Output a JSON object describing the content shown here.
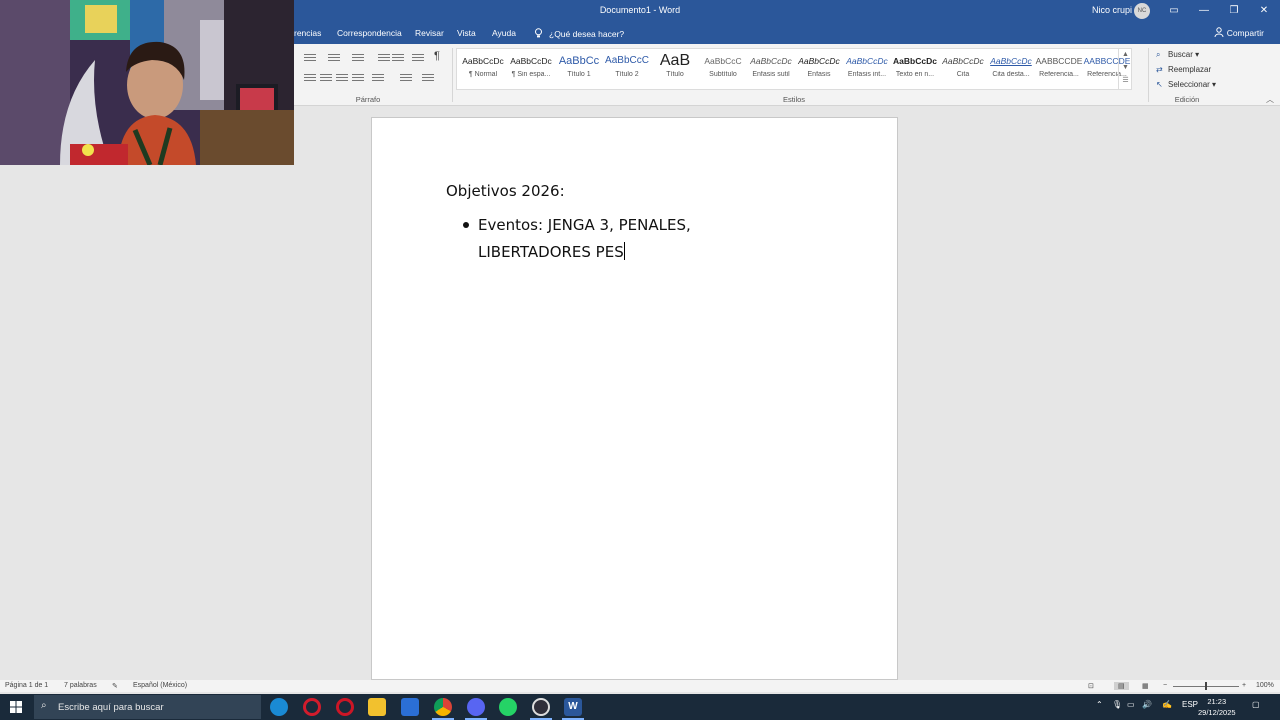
{
  "window": {
    "title": "Documento1 - Word",
    "user_name": "Nico crupi",
    "user_initials": "NC",
    "controls": {
      "minimize": "—",
      "restore": "❐",
      "close": "✕"
    },
    "ribbon_display_icon": "▭"
  },
  "menu": {
    "tabs": [
      "rencias",
      "Correspondencia",
      "Revisar",
      "Vista",
      "Ayuda"
    ],
    "tell_me": "¿Qué desea hacer?",
    "share": "Compartir"
  },
  "ribbon": {
    "paragraph_label": "Párrafo",
    "styles_label": "Estilos",
    "editing_label": "Edición",
    "pilcrow": "¶",
    "styles": [
      {
        "sample": "AaBbCcDc",
        "name": "¶ Normal"
      },
      {
        "sample": "AaBbCcDc",
        "name": "¶ Sin espa..."
      },
      {
        "sample": "AaBbCc",
        "name": "Título 1"
      },
      {
        "sample": "AaBbCcC",
        "name": "Título 2"
      },
      {
        "sample": "AaB",
        "name": "Título"
      },
      {
        "sample": "AaBbCcC",
        "name": "Subtítulo"
      },
      {
        "sample": "AaBbCcDc",
        "name": "Énfasis sutil"
      },
      {
        "sample": "AaBbCcDc",
        "name": "Énfasis"
      },
      {
        "sample": "AaBbCcDc",
        "name": "Énfasis int..."
      },
      {
        "sample": "AaBbCcDc",
        "name": "Texto en n..."
      },
      {
        "sample": "AaBbCcDc",
        "name": "Cita"
      },
      {
        "sample": "AaBbCcDc",
        "name": "Cita desta..."
      },
      {
        "sample": "AABBCCDE",
        "name": "Referencia..."
      },
      {
        "sample": "AABBCCDE",
        "name": "Referencia..."
      }
    ],
    "editing": {
      "find": "Buscar",
      "replace": "Reemplazar",
      "select": "Seleccionar"
    }
  },
  "document": {
    "heading": "Objetivos 2026:",
    "bullet_line1": "Eventos: JENGA 3, PENALES,",
    "bullet_line2": "LIBERTADORES PES"
  },
  "statusbar": {
    "page": "Página 1 de 1",
    "words": "7 palabras",
    "language": "Español (México)",
    "zoom": "100%",
    "zoom_minus": "−",
    "zoom_plus": "+"
  },
  "taskbar": {
    "search_placeholder": "Escribe aquí para buscar",
    "search_icon": "⌕",
    "apps": [
      {
        "name": "edge",
        "color": "#1a8ad4"
      },
      {
        "name": "opera-gx",
        "color": "#d21c2c"
      },
      {
        "name": "opera",
        "color": "#cc1626"
      },
      {
        "name": "file-explorer",
        "color": "#f2c12e"
      },
      {
        "name": "microsoft-store",
        "color": "#2b6fd6"
      },
      {
        "name": "chrome",
        "color": "#3b9d44"
      },
      {
        "name": "discord",
        "color": "#5865f2"
      },
      {
        "name": "whatsapp",
        "color": "#25d366"
      },
      {
        "name": "obs",
        "color": "#302f3a"
      },
      {
        "name": "word",
        "color": "#2b579a"
      }
    ],
    "language": "ESP",
    "time": "21:23",
    "date": "29/12/2025"
  },
  "colors": {
    "word_blue": "#2b579a",
    "taskbar": "#1a2a3a",
    "ribbon": "#f3f3f3",
    "canvas": "#e6e6e6"
  }
}
